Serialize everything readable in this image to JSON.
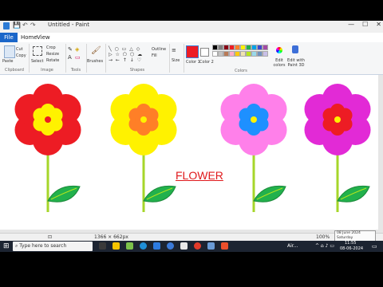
{
  "window": {
    "title": "Untitled - Paint",
    "minimize": "—",
    "maximize": "☐",
    "close": "✕"
  },
  "menu": {
    "file": "File",
    "home": "Home",
    "view": "View"
  },
  "ribbon": {
    "clipboard": "Clipboard",
    "paste": "Paste",
    "cut": "Cut",
    "copy": "Copy",
    "image": "Image",
    "select": "Select",
    "crop": "Crop",
    "resize": "Resize",
    "rotate": "Rotate",
    "tools": "Tools",
    "brushes": "Brushes",
    "shapes": "Shapes",
    "outline": "Outline",
    "fill": "Fill",
    "size": "Size",
    "color1": "Color 1",
    "color2": "Color 2",
    "colors": "Colors",
    "edit_colors": "Edit colors",
    "edit_with_paint3d": "Edit with Paint 3D"
  },
  "palette": [
    "#000000",
    "#7f7f7f",
    "#880015",
    "#ed1c24",
    "#ff7f27",
    "#fff200",
    "#22b14c",
    "#00a2e8",
    "#3f48cc",
    "#a349a4",
    "#ffffff",
    "#c3c3c3",
    "#b97a57",
    "#ffaec9",
    "#ffc90e",
    "#efe4b0",
    "#b5e61d",
    "#99d9ea",
    "#7092be",
    "#c8bfe7"
  ],
  "canvas": {
    "heading": "FLOWER"
  },
  "flowers": [
    {
      "petal": "#ed1c24",
      "inner": "#fff200",
      "center": "#ed1c24"
    },
    {
      "petal": "#fff200",
      "inner": "#ff7f27",
      "center": "#fff200"
    },
    {
      "petal": "#ff80ea",
      "inner": "#1e90ff",
      "center": "#fff200"
    },
    {
      "petal": "#e22ad6",
      "inner": "#ed1c24",
      "center": "#fff200"
    }
  ],
  "status": {
    "size": "1366 × 662px",
    "zoom": "100%"
  },
  "tooltip": {
    "date": "08 June 2024",
    "day": "Saturday"
  },
  "taskbar": {
    "search_placeholder": "Type here to search",
    "weather": "Air...",
    "time": "11:55",
    "date": "08-06-2024"
  }
}
